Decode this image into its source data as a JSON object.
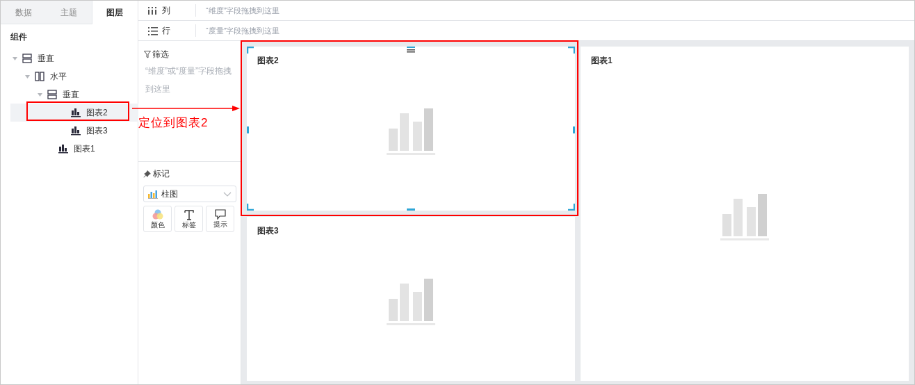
{
  "tabs": [
    {
      "label": "数据",
      "selected": false
    },
    {
      "label": "主题",
      "selected": false
    },
    {
      "label": "图层",
      "selected": true
    }
  ],
  "components": {
    "title": "组件",
    "tree": [
      {
        "label": "垂直",
        "kind": "vertical",
        "expanded": true,
        "selected": false,
        "children": [
          {
            "label": "水平",
            "kind": "horizontal",
            "expanded": true,
            "selected": false,
            "children": [
              {
                "label": "垂直",
                "kind": "vertical",
                "expanded": true,
                "selected": false,
                "children": [
                  {
                    "label": "图表2",
                    "kind": "chart",
                    "selected": true
                  },
                  {
                    "label": "图表3",
                    "kind": "chart",
                    "selected": false
                  }
                ]
              },
              {
                "label": "图表1",
                "kind": "chart",
                "selected": false
              }
            ]
          }
        ]
      }
    ]
  },
  "shelves": [
    {
      "kind": "columns",
      "label": "列",
      "hint": "“维度”字段拖拽到这里"
    },
    {
      "kind": "rows",
      "label": "行",
      "hint": "“度量”字段拖拽到这里"
    }
  ],
  "filter": {
    "label": "筛选",
    "hint": "“维度”或“度量”字段拖拽到这里"
  },
  "marks": {
    "label": "标记",
    "chart_type": "柱图",
    "buttons": [
      {
        "label": "颜色",
        "kind": "color"
      },
      {
        "label": "标签",
        "kind": "label"
      },
      {
        "label": "提示",
        "kind": "tooltip"
      }
    ]
  },
  "charts": [
    {
      "title": "图表2",
      "selected": true
    },
    {
      "title": "图表3",
      "selected": false
    },
    {
      "title": "图表1",
      "selected": false
    }
  ],
  "annotation": {
    "callout": "定位到图表2"
  }
}
